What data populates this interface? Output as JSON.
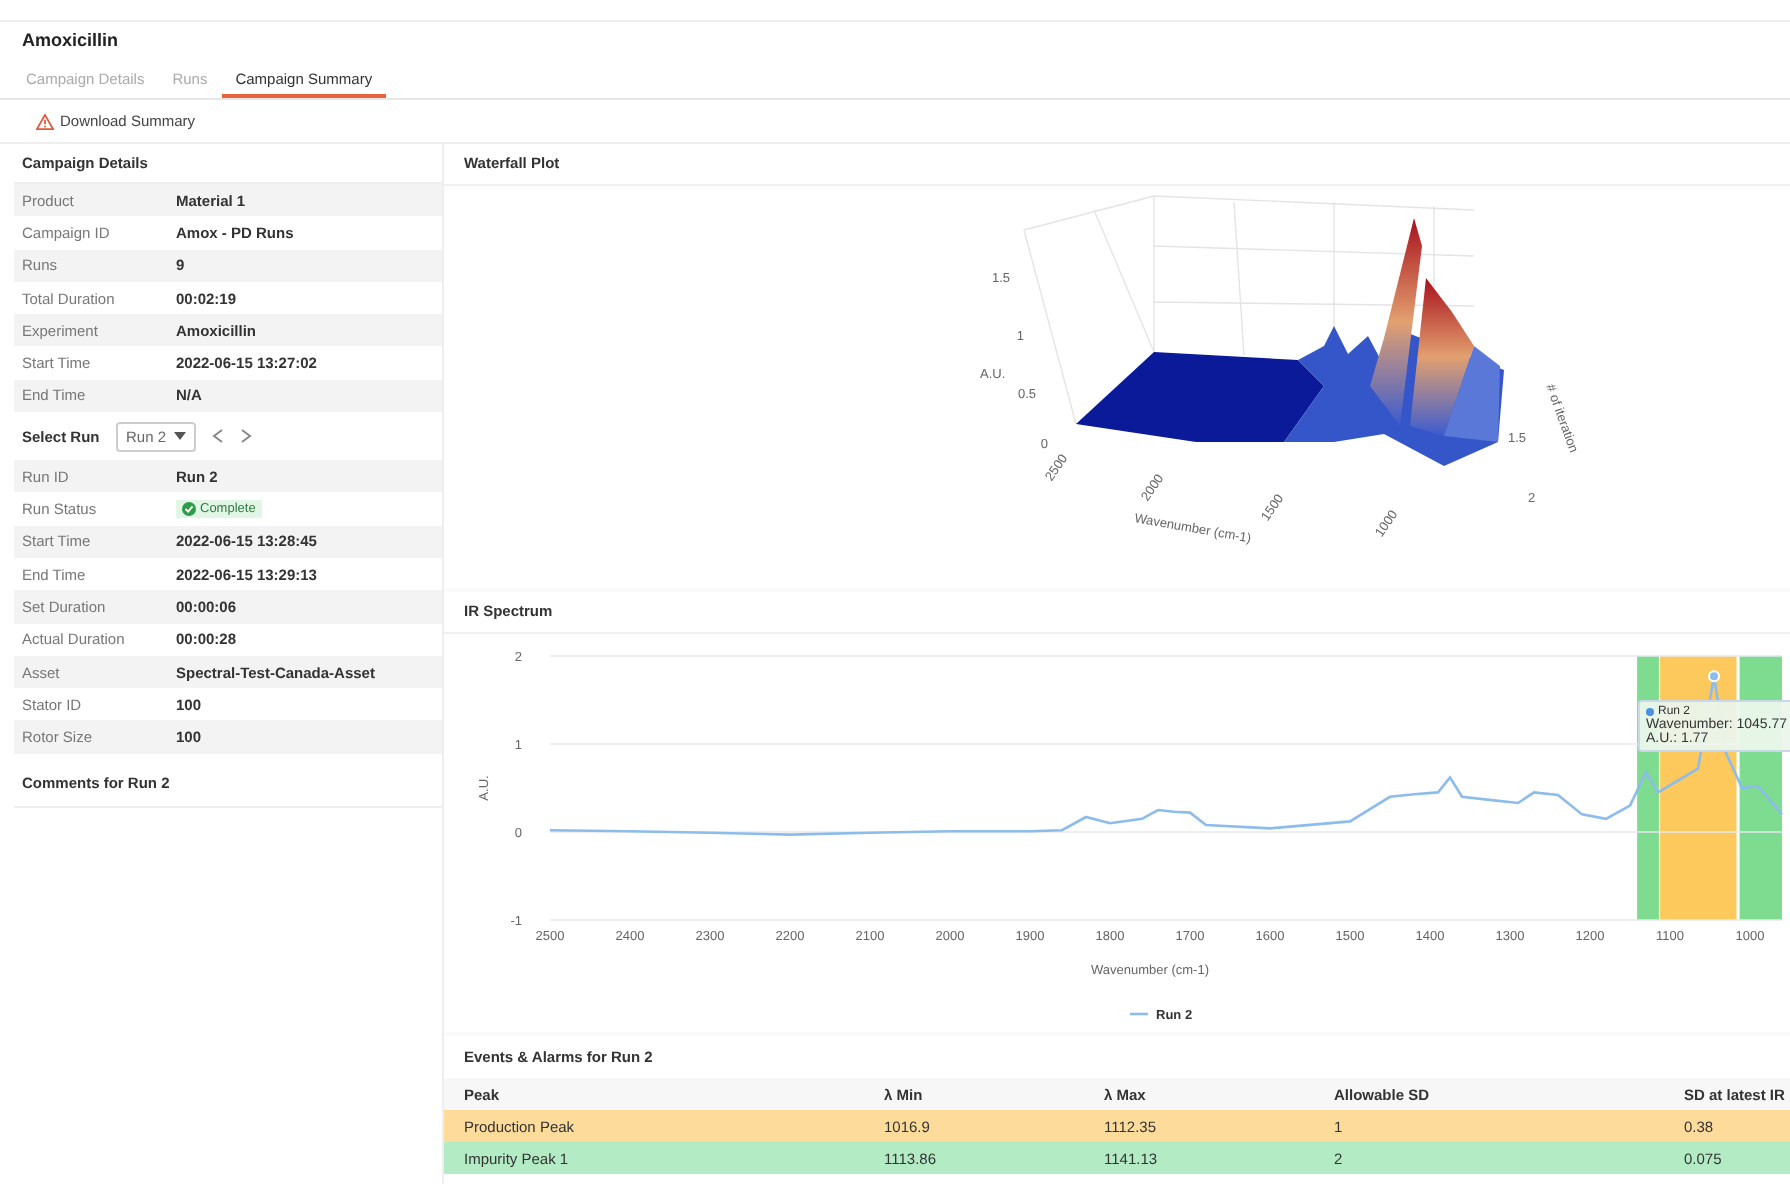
{
  "title": "Amoxicillin",
  "tabs": [
    {
      "label": "Campaign Details",
      "selected": false
    },
    {
      "label": "Runs",
      "selected": false
    },
    {
      "label": "Campaign Summary",
      "selected": true
    }
  ],
  "download_button": "Download Summary",
  "campaign_details": {
    "title": "Campaign Details",
    "rows": [
      {
        "label": "Product",
        "value": "Material 1"
      },
      {
        "label": "Campaign ID",
        "value": "Amox - PD Runs"
      },
      {
        "label": "Runs",
        "value": "9"
      },
      {
        "label": "Total Duration",
        "value": "00:02:19"
      },
      {
        "label": "Experiment",
        "value": "Amoxicillin"
      },
      {
        "label": "Start Time",
        "value": "2022-06-15 13:27:02"
      },
      {
        "label": "End Time",
        "value": "N/A"
      }
    ]
  },
  "select_run": {
    "label": "Select Run",
    "value": "Run 2"
  },
  "run_details": [
    {
      "label": "Run ID",
      "value": "Run 2",
      "kind": "text"
    },
    {
      "label": "Run Status",
      "value": "Complete",
      "kind": "status"
    },
    {
      "label": "Start Time",
      "value": "2022-06-15 13:28:45",
      "kind": "text"
    },
    {
      "label": "End Time",
      "value": "2022-06-15 13:29:13",
      "kind": "text"
    },
    {
      "label": "Set Duration",
      "value": "00:00:06",
      "kind": "text"
    },
    {
      "label": "Actual Duration",
      "value": "00:00:28",
      "kind": "text"
    },
    {
      "label": "Asset",
      "value": "Spectral-Test-Canada-Asset",
      "kind": "text"
    },
    {
      "label": "Stator ID",
      "value": "100",
      "kind": "text"
    },
    {
      "label": "Rotor Size",
      "value": "100",
      "kind": "text"
    }
  ],
  "comments_title": "Comments for Run 2",
  "waterfall": {
    "title": "Waterfall Plot",
    "z_title": "A.U.",
    "z_ticks": [
      "1.5",
      "1",
      "0.5",
      "0"
    ],
    "x_title": "Wavenumber (cm-1)",
    "x_ticks": [
      "2500",
      "2000",
      "1500",
      "1000"
    ],
    "y_title": "# of iteration",
    "y_ticks": [
      "1.5",
      "2"
    ]
  },
  "ir_spectrum": {
    "title": "IR Spectrum",
    "tooltip": {
      "series": "Run 2",
      "lines": [
        "Wavenumber: 1045.77",
        "A.U.: 1.77"
      ]
    },
    "chart_data": {
      "type": "line",
      "xlabel": "Wavenumber (cm-1)",
      "ylabel": "A.U.",
      "x": [
        2500,
        2400,
        2300,
        2200,
        2100,
        2000,
        1900,
        1860,
        1830,
        1800,
        1760,
        1740,
        1720,
        1700,
        1680,
        1600,
        1500,
        1450,
        1420,
        1390,
        1375,
        1360,
        1320,
        1290,
        1270,
        1240,
        1210,
        1180,
        1150,
        1130,
        1115,
        1065,
        1045,
        1030,
        1010,
        990,
        960
      ],
      "series": [
        {
          "name": "Run 2",
          "color": "#8cbcec",
          "values": [
            0.02,
            0.01,
            -0.01,
            -0.03,
            -0.01,
            0.01,
            0.01,
            0.02,
            0.17,
            0.1,
            0.15,
            0.25,
            0.23,
            0.22,
            0.08,
            0.04,
            0.12,
            0.4,
            0.43,
            0.45,
            0.62,
            0.4,
            0.36,
            0.33,
            0.45,
            0.42,
            0.2,
            0.15,
            0.3,
            0.68,
            0.45,
            0.72,
            1.77,
            0.9,
            0.5,
            0.52,
            0.2
          ]
        }
      ],
      "xlim": [
        2500,
        960
      ],
      "ylim": [
        -1,
        2
      ],
      "xticks": [
        2500,
        2400,
        2300,
        2200,
        2100,
        2000,
        1900,
        1800,
        1700,
        1600,
        1500,
        1400,
        1300,
        1200,
        1100,
        1000
      ],
      "yticks": [
        -1,
        0,
        1,
        2
      ],
      "bands": [
        {
          "axis": "x",
          "from": 1141.13,
          "to": 1113.86,
          "color": "#7ddc8f"
        },
        {
          "axis": "x",
          "from": 1112.35,
          "to": 1016.9,
          "color": "#fdc95c"
        },
        {
          "axis": "x",
          "from": 1013,
          "to": 960,
          "color": "#7ddc8f"
        }
      ]
    }
  },
  "events": {
    "title": "Events & Alarms for Run 2",
    "columns": [
      "Peak",
      "λ Min",
      "λ Max",
      "Allowable SD",
      "SD at latest IR"
    ],
    "rows": [
      {
        "cells": [
          "Production Peak",
          "1016.9",
          "1112.35",
          "1",
          "0.38"
        ],
        "color": "#fddc9b"
      },
      {
        "cells": [
          "Impurity Peak 1",
          "1113.86",
          "1141.13",
          "2",
          "0.075"
        ],
        "color": "#b3ebc4"
      }
    ]
  }
}
